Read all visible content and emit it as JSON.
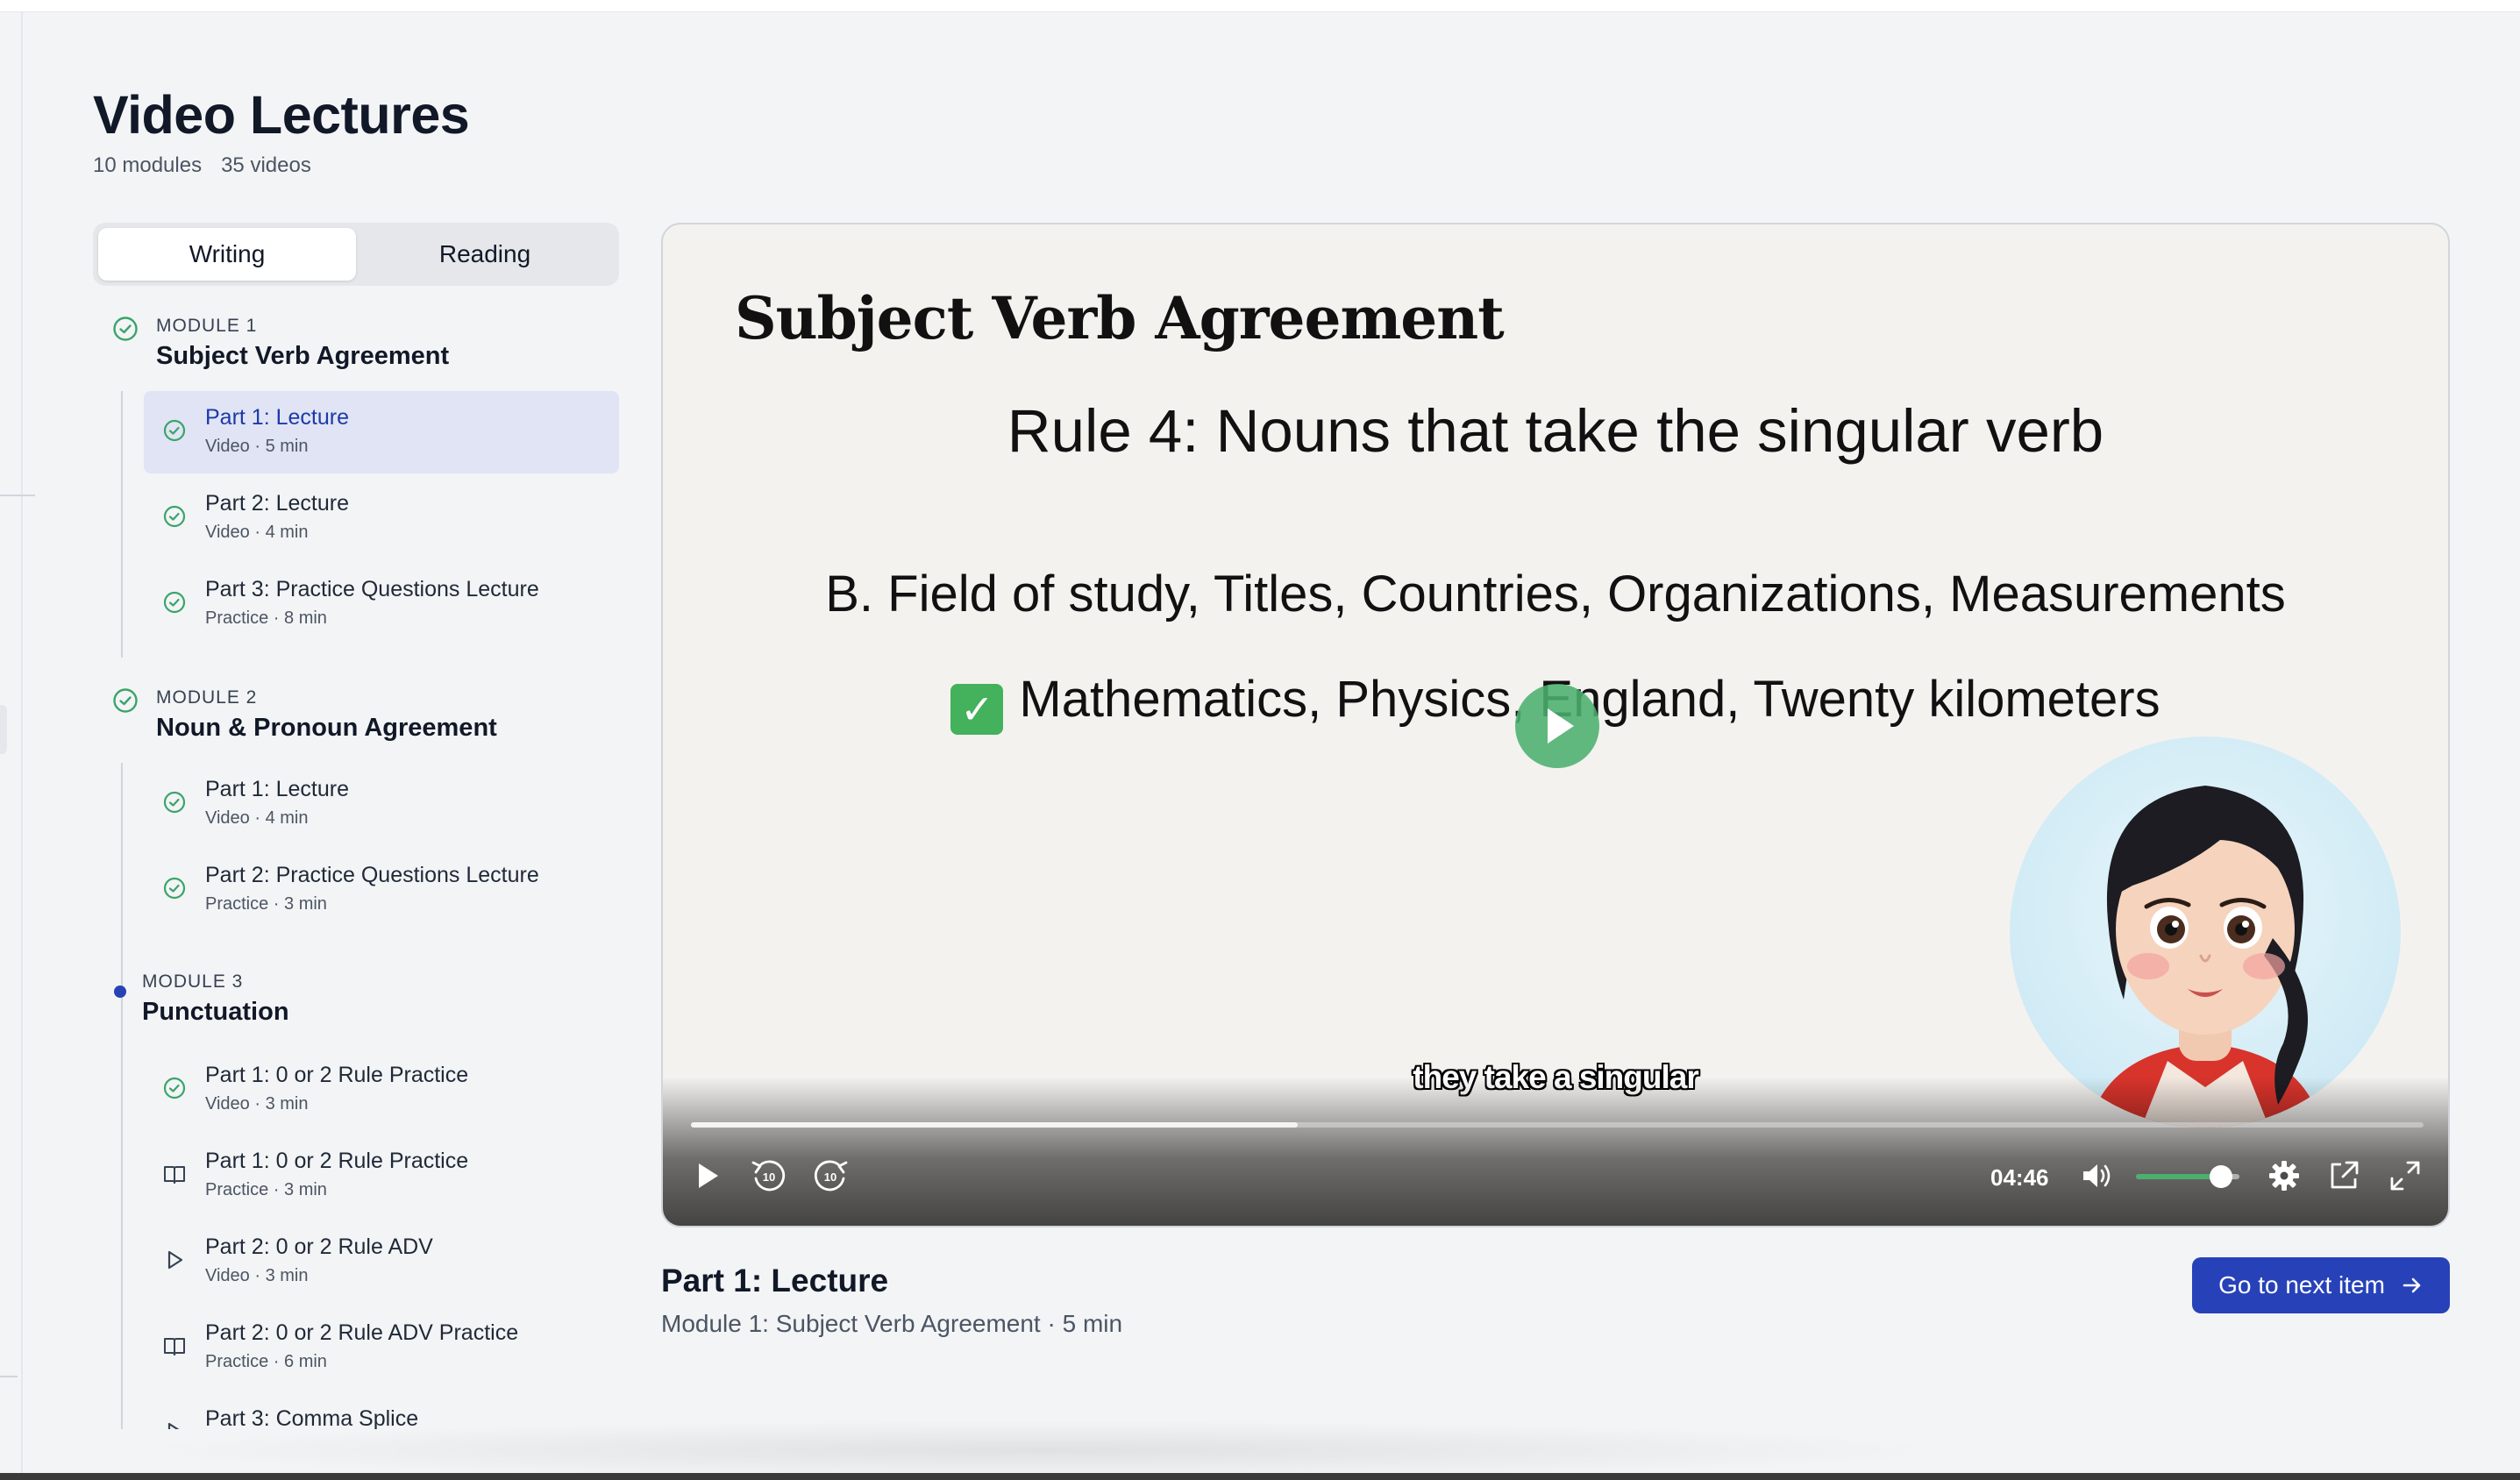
{
  "page": {
    "title": "Video Lectures",
    "modules_count": "10 modules",
    "videos_count": "35 videos"
  },
  "tabs": [
    {
      "label": "Writing",
      "active": true
    },
    {
      "label": "Reading",
      "active": false
    }
  ],
  "modules": [
    {
      "label": "MODULE 1",
      "title": "Subject Verb Agreement",
      "status": "complete",
      "items": [
        {
          "title": "Part 1: Lecture",
          "sub": "Video · 5 min",
          "icon": "check-circle-icon",
          "active": true
        },
        {
          "title": "Part 2: Lecture",
          "sub": "Video · 4 min",
          "icon": "check-circle-icon"
        },
        {
          "title": "Part 3: Practice Questions Lecture",
          "sub": "Practice · 8 min",
          "icon": "check-circle-icon"
        }
      ]
    },
    {
      "label": "MODULE 2",
      "title": "Noun & Pronoun Agreement",
      "status": "complete",
      "items": [
        {
          "title": "Part 1: Lecture",
          "sub": "Video · 4 min",
          "icon": "check-circle-icon"
        },
        {
          "title": "Part 2: Practice Questions Lecture",
          "sub": "Practice · 3 min",
          "icon": "check-circle-icon"
        }
      ]
    },
    {
      "label": "MODULE 3",
      "title": "Punctuation",
      "status": "in-progress",
      "items": [
        {
          "title": "Part 1: 0 or 2 Rule Practice",
          "sub": "Video · 3 min",
          "icon": "check-circle-icon"
        },
        {
          "title": "Part 1: 0 or 2 Rule Practice",
          "sub": "Practice · 3 min",
          "icon": "book-icon"
        },
        {
          "title": "Part 2: 0 or 2 Rule ADV",
          "sub": "Video · 3 min",
          "icon": "play-icon"
        },
        {
          "title": "Part 2: 0 or 2 Rule ADV Practice",
          "sub": "Practice · 6 min",
          "icon": "book-icon"
        },
        {
          "title": "Part 3: Comma Splice",
          "sub": "",
          "icon": "play-icon"
        }
      ]
    }
  ],
  "video": {
    "slide_heading": "Subject Verb Agreement",
    "rule": "Rule 4: Nouns that take the singular verb",
    "fields": "B. Field of study, Titles, Countries, Organizations, Measurements",
    "check_glyph": "✓",
    "examples": "Mathematics, Physics, England, Twenty kilometers",
    "caption": "they take a singular",
    "time": "04:46",
    "progress": 0.35,
    "volume": 0.82,
    "rewind_label": "10",
    "forward_label": "10"
  },
  "lesson": {
    "title": "Part 1: Lecture",
    "subtitle": "Module 1: Subject Verb Agreement · 5 min",
    "next_label": "Go to next item"
  },
  "colors": {
    "accent": "#2742b8",
    "complete": "#3aa46a",
    "active_row": "#e0e4f4",
    "volume": "#4caf6e"
  }
}
